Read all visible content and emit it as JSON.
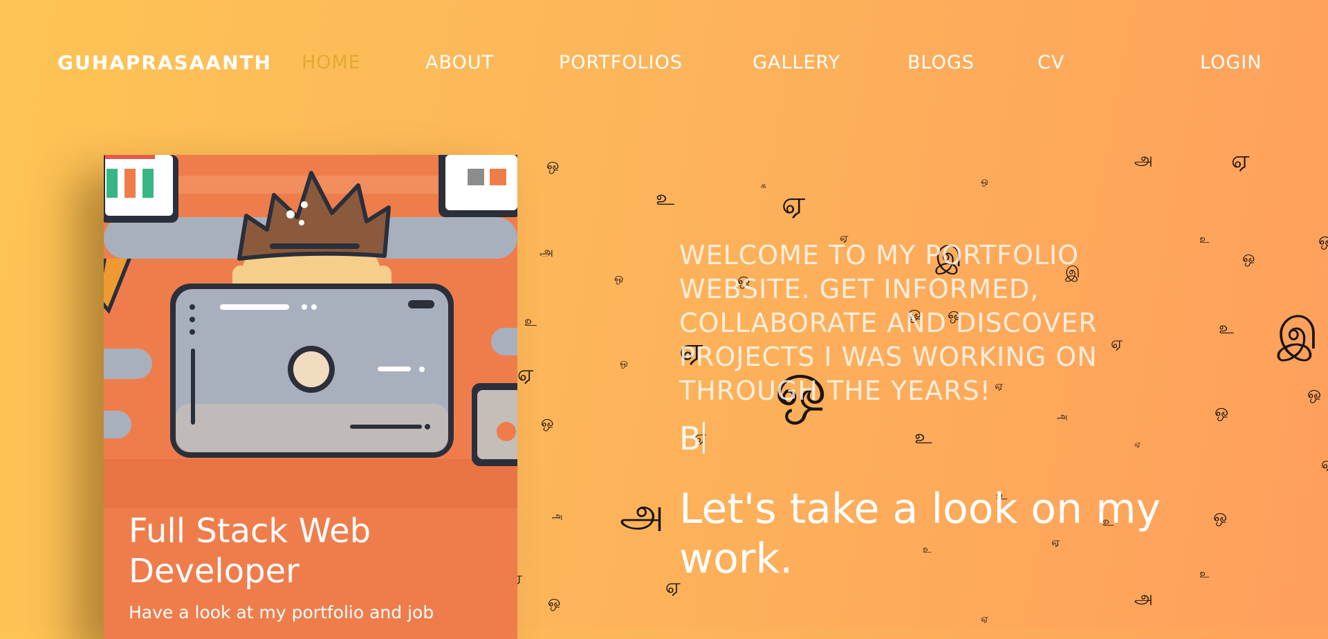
{
  "nav": {
    "brand": "GUHAPRASAANTH",
    "links": [
      {
        "label": "HOME",
        "active": true
      },
      {
        "label": "ABOUT",
        "active": false
      },
      {
        "label": "PORTFOLIOS",
        "active": false
      },
      {
        "label": "GALLERY",
        "active": false
      },
      {
        "label": "BLOGS",
        "active": false
      },
      {
        "label": "CV",
        "active": false
      }
    ],
    "login": "LOGIN",
    "active_color": "#dfab33"
  },
  "card": {
    "title": "Full Stack Web Developer",
    "description": "Have a look at my portfolio and job",
    "illustration": "developer-at-computer-illustration",
    "background_color": "#ef7d4c"
  },
  "hero": {
    "welcome": "WELCOME TO MY PORTFOLIO WEBSITE. GET INFORMED, COLLABORATE AND DISCOVER PROJECTS I WAS WORKING ON THROUGH THE YEARS!",
    "typed_text": "B",
    "tagline": "Let's take a look on my work."
  },
  "background": {
    "gradient": [
      "#fdc455",
      "#fe9f5c"
    ],
    "decoration": "scattered-tamil-letters"
  }
}
